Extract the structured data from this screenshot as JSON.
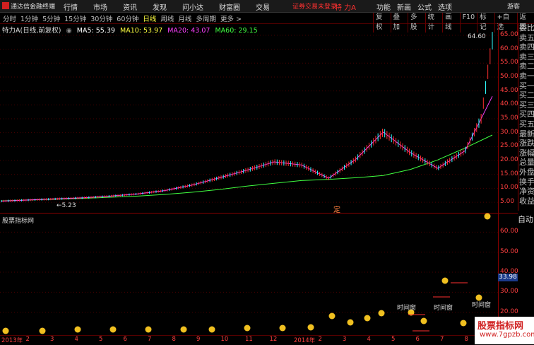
{
  "app": {
    "title": "通达信金融终端"
  },
  "top_menu": [
    "行情",
    "市场",
    "资讯",
    "发现",
    "问小达",
    "财富圈",
    "交易"
  ],
  "login_status": "证券交易未登录",
  "stock_title": "特 力A",
  "right_menu": [
    "功能",
    "新画",
    "公式",
    "选项"
  ],
  "guest": "游客",
  "periods": [
    {
      "label": "分时"
    },
    {
      "label": "1分钟"
    },
    {
      "label": "5分钟"
    },
    {
      "label": "15分钟"
    },
    {
      "label": "30分钟"
    },
    {
      "label": "60分钟"
    },
    {
      "label": "日线",
      "active": true
    },
    {
      "label": "周线"
    },
    {
      "label": "月线"
    },
    {
      "label": "多周期"
    },
    {
      "label": "更多 >"
    }
  ],
  "tool_buttons": [
    "复权",
    "叠加",
    "多股",
    "统计",
    "画线",
    "F10",
    "标记",
    "+自选",
    "返回"
  ],
  "ma": {
    "name": "特力A(日线,前复权)",
    "ma5": "MA5: 55.39",
    "ma10": "MA10: 53.97",
    "ma20": "MA20: 43.07",
    "ma60": "MA60: 29.15",
    "colors": {
      "ma5": "#ffffff",
      "ma10": "#ffff40",
      "ma20": "#ff40ff",
      "ma60": "#40ff40"
    }
  },
  "price_axis": [
    "65.00",
    "60.00",
    "55.00",
    "50.00",
    "45.00",
    "40.00",
    "35.00",
    "30.00",
    "25.00",
    "20.00",
    "15.00",
    "10.00",
    "5.00"
  ],
  "high_label": "64.60",
  "low_label": "5.23",
  "fixed_marker": "定",
  "side_panel": [
    "委比",
    "卖五",
    "卖四",
    "卖三",
    "卖二",
    "卖一",
    "买一",
    "买二",
    "买三",
    "买四",
    "买五",
    "最新",
    "涨跌",
    "涨幅",
    "总量",
    "外盘",
    "换手",
    "净资",
    "收益"
  ],
  "auto_button": "自动",
  "indicator": {
    "title": "股票指标网",
    "axis": [
      "60.00",
      "50.00",
      "40.00",
      "30.00",
      "20.00"
    ],
    "value_box": "33.98",
    "labels": [
      "时间窗",
      "时间窗",
      "时间窗"
    ]
  },
  "dates": [
    "2013年",
    "2",
    "3",
    "4",
    "5",
    "6",
    "7",
    "8",
    "9",
    "10",
    "11",
    "12",
    "2014年",
    "2",
    "3",
    "4",
    "5",
    "6",
    "7",
    "8",
    "9"
  ],
  "watermark": {
    "line1": "股票指标网",
    "line2": "www.7gpzb.com"
  },
  "chart_data": {
    "type": "line",
    "title": "",
    "ylim": [
      4,
      66
    ],
    "series": [
      {
        "name": "MA60",
        "values": [
          5.5,
          5.8,
          6.1,
          6.4,
          6.8,
          7.2,
          7.8,
          8.6,
          9.6,
          10.8,
          11.8,
          12.8,
          13.2,
          13.8,
          14.6,
          16.8,
          20.2,
          24.5,
          29.15
        ]
      },
      {
        "name": "MA20",
        "values": [
          5.4,
          5.8,
          6.2,
          6.6,
          7.2,
          8.0,
          9.2,
          11.2,
          13.8,
          16.5,
          19.5,
          18.4,
          13.6,
          20.5,
          30.2,
          22.8,
          17.2,
          23.5,
          43.07
        ]
      }
    ]
  }
}
